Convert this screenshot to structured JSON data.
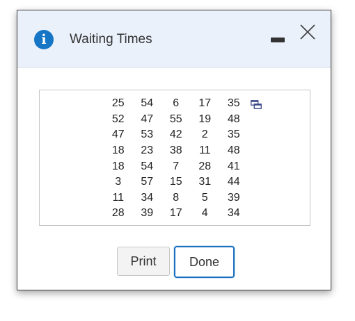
{
  "dialog": {
    "title": "Waiting Times",
    "info_icon_glyph": "i",
    "accent_color": "#1675c5",
    "header_bg": "#eaf1fb"
  },
  "table": {
    "rows": [
      [
        "25",
        "54",
        "6",
        "17",
        "35"
      ],
      [
        "52",
        "47",
        "55",
        "19",
        "48"
      ],
      [
        "47",
        "53",
        "42",
        "2",
        "35"
      ],
      [
        "18",
        "23",
        "38",
        "11",
        "48"
      ],
      [
        "18",
        "54",
        "7",
        "28",
        "41"
      ],
      [
        "3",
        "57",
        "15",
        "31",
        "44"
      ],
      [
        "11",
        "34",
        "8",
        "5",
        "39"
      ],
      [
        "28",
        "39",
        "17",
        "4",
        "34"
      ]
    ]
  },
  "buttons": {
    "print_label": "Print",
    "done_label": "Done"
  },
  "icons": {
    "info": "info-icon",
    "minimize": "minimize-icon",
    "close": "close-icon",
    "copy": "copy-icon"
  }
}
